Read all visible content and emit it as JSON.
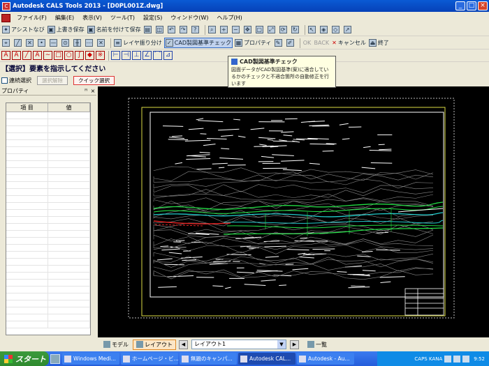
{
  "window": {
    "title": "Autodesk CALS Tools 2013 - [D0PL001Z.dwg]",
    "app_icon": "CALS",
    "min": "_",
    "max": "□",
    "close": "×"
  },
  "menu": [
    {
      "label": "ファイル(F)"
    },
    {
      "label": "編集(E)"
    },
    {
      "label": "表示(V)"
    },
    {
      "label": "ツール(T)"
    },
    {
      "label": "設定(S)"
    },
    {
      "label": "ウィンドウ(W)"
    },
    {
      "label": "ヘルプ(H)"
    }
  ],
  "toolbar1": {
    "assist": "アシストなび",
    "overwrite_save": "上書き保存",
    "save_as": "名前を付けて保存"
  },
  "toolbar2": {
    "layer_split": "レイヤ振り分け",
    "cad_check": "CAD製図基準チェック",
    "property": "プロパティ",
    "ok": "OK",
    "back": "BACK",
    "cancel": "キャンセル",
    "end": "終了"
  },
  "command": {
    "prompt": "【選択】要素を指示してください"
  },
  "options": {
    "continuous_select": "連続選択",
    "select_release": "選択解除",
    "quick_select": "クイック選択"
  },
  "tooltip": {
    "title": "CAD製図基準チェック",
    "body": "図面データがCAD製図基準(案)に適合しているかのチェックと不適合箇所の自動修正を行います"
  },
  "property_panel": {
    "title": "プロパティ",
    "pin": "ꟸ",
    "close": "×",
    "col_item": "項 目",
    "col_value": "値"
  },
  "bottom": {
    "model_tab": "モデル",
    "layout_tab": "レイアウト",
    "layout_combo": "レイアウト1",
    "list_label": "一覧"
  },
  "taskbar": {
    "start": "スタート",
    "tasks": [
      {
        "label": "Windows Medi..."
      },
      {
        "label": "ホームページ・ビ..."
      },
      {
        "label": "無題のキャンパ..."
      },
      {
        "label": "Autodesk CAL..."
      },
      {
        "label": "Autodesk - Au..."
      }
    ],
    "tray_caps": "CAPS KANA",
    "clock": "9:52"
  },
  "colors": {
    "accent": "#0a5ad4",
    "canvas": "#000000",
    "road_green": "#22dd44",
    "road_cyan": "#22cccc",
    "road_red": "#dd2222"
  }
}
